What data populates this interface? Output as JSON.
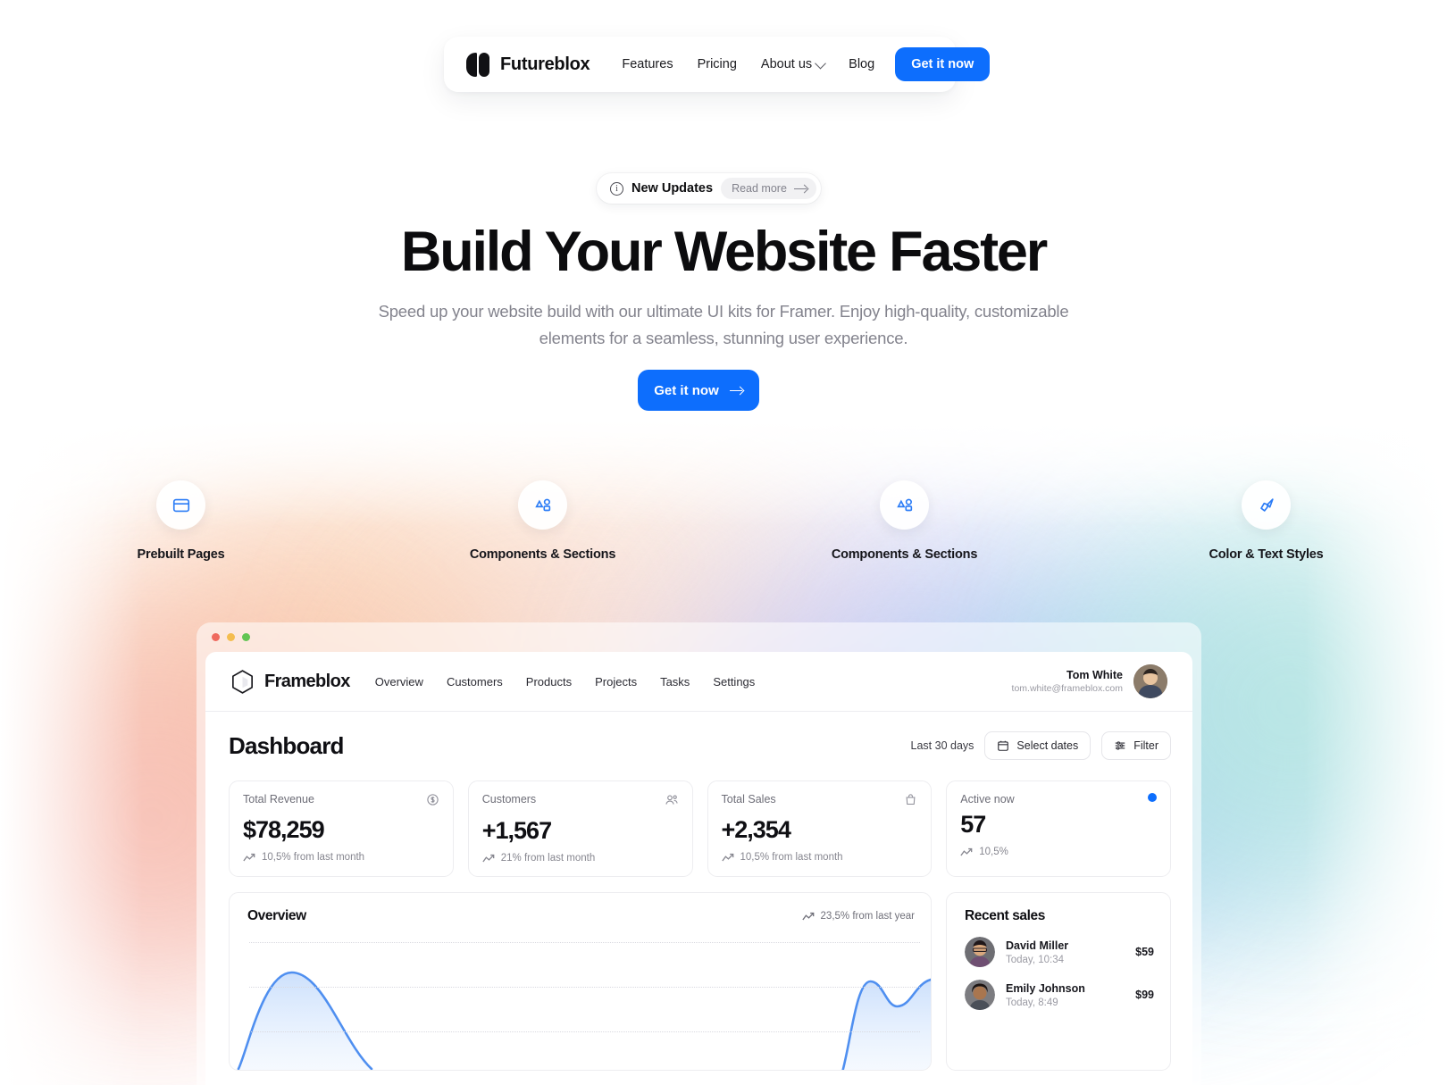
{
  "navbar": {
    "brand": "Futureblox",
    "links": [
      {
        "label": "Features",
        "has_chevron": false
      },
      {
        "label": "Pricing",
        "has_chevron": false
      },
      {
        "label": "About us",
        "has_chevron": true
      },
      {
        "label": "Blog",
        "has_chevron": false
      }
    ],
    "cta": "Get it now"
  },
  "badge": {
    "icon": "info-icon",
    "title": "New Updates",
    "more_label": "Read more"
  },
  "hero": {
    "title": "Build Your Website Faster",
    "subtitle": "Speed up your website build with our ultimate UI kits for Framer. Enjoy high-quality, customizable elements for a seamless, stunning user experience.",
    "cta": "Get it now"
  },
  "features": [
    {
      "icon": "layout-page-icon",
      "label": "Prebuilt Pages"
    },
    {
      "icon": "shapes-components-icon",
      "label": "Components & Sections"
    },
    {
      "icon": "shapes-components-icon",
      "label": "Components & Sections"
    },
    {
      "icon": "paintbrush-icon",
      "label": "Color & Text Styles"
    }
  ],
  "dashboard": {
    "window_dots": [
      "red",
      "yellow",
      "green"
    ],
    "brand": "Frameblox",
    "nav": [
      "Overview",
      "Customers",
      "Products",
      "Projects",
      "Tasks",
      "Settings"
    ],
    "user": {
      "name": "Tom White",
      "email": "tom.white@frameblox.com"
    },
    "title": "Dashboard",
    "controls": {
      "range_label": "Last 30 days",
      "select_dates": "Select dates",
      "filter": "Filter"
    },
    "stats": [
      {
        "label": "Total Revenue",
        "value": "$78,259",
        "delta": "10,5% from last month",
        "icon": "dollar-circle-icon"
      },
      {
        "label": "Customers",
        "value": "+1,567",
        "delta": "21% from last month",
        "icon": "users-icon"
      },
      {
        "label": "Total Sales",
        "value": "+2,354",
        "delta": "10,5% from last month",
        "icon": "shopping-bag-icon"
      },
      {
        "label": "Active now",
        "value": "57",
        "delta": "10,5%",
        "icon": "active-dot-icon"
      }
    ],
    "overview": {
      "title": "Overview",
      "meta": "23,5% from last year"
    },
    "recent_sales": {
      "title": "Recent sales",
      "rows": [
        {
          "name": "David Miller",
          "time": "Today, 10:34",
          "amount": "$59"
        },
        {
          "name": "Emily Johnson",
          "time": "Today, 8:49",
          "amount": "$99"
        }
      ]
    }
  },
  "colors": {
    "accent": "#0d6efd",
    "text": "#0f0f13",
    "muted": "#83838d"
  },
  "chart_data": {
    "type": "area",
    "title": "Overview",
    "x": [
      0,
      1,
      2,
      3,
      4,
      5,
      6,
      7,
      8,
      9,
      10
    ],
    "values": [
      30,
      72,
      58,
      26,
      14,
      10,
      12,
      18,
      24,
      62,
      54
    ],
    "xlabel": "",
    "ylabel": "",
    "grid": true,
    "legend": "none",
    "annotation": "23,5% from last year"
  }
}
